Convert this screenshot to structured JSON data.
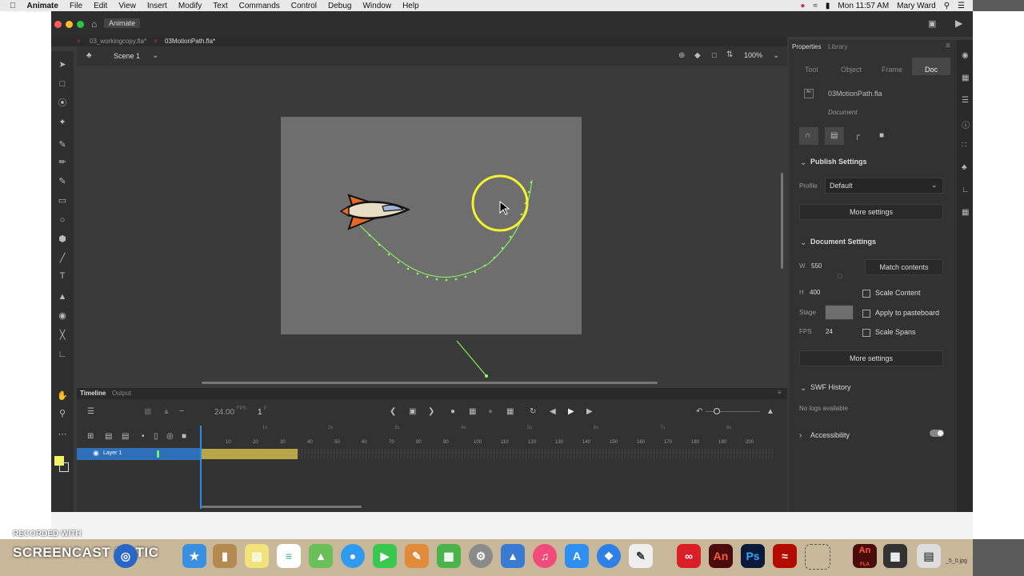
{
  "menubar": {
    "app_name": "Animate",
    "items": [
      "File",
      "Edit",
      "View",
      "Insert",
      "Modify",
      "Text",
      "Commands",
      "Control",
      "Debug",
      "Window",
      "Help"
    ],
    "clock": "Mon 11:57 AM",
    "user": "Mary Ward"
  },
  "titlebar": {
    "workspace_label": "Animate"
  },
  "doc_tabs": [
    "03_workingcopy.fla*",
    "03MotionPath.fla*"
  ],
  "scene": {
    "name": "Scene 1",
    "zoom": "100%"
  },
  "timeline": {
    "tabs": [
      "Timeline",
      "Output"
    ],
    "fps": "24.00",
    "fps_unit": "FPS",
    "current_frame": "1",
    "frame_suffix": "F",
    "layer_name": "Layer 1",
    "ruler": [
      "10",
      "20",
      "30",
      "40",
      "50",
      "60",
      "70",
      "80",
      "90",
      "100",
      "110",
      "120",
      "130",
      "140",
      "150",
      "160",
      "170",
      "180",
      "190",
      "200"
    ],
    "seconds": [
      "1s",
      "2s",
      "3s",
      "4s",
      "5s",
      "6s",
      "7s",
      "8s"
    ]
  },
  "properties": {
    "tabs": [
      "Properties",
      "Library"
    ],
    "sub_tabs": [
      "Tool",
      "Object",
      "Frame",
      "Doc"
    ],
    "file_name": "03MotionPath.fla",
    "doc_label": "Document",
    "publish_settings": "Publish Settings",
    "profile_label": "Profile",
    "profile_value": "Default",
    "more_settings": "More settings",
    "document_settings": "Document Settings",
    "w_label": "W",
    "w_value": "550",
    "h_label": "H",
    "h_value": "400",
    "match_contents": "Match contents",
    "scale_content": "Scale Content",
    "stage_label": "Stage",
    "apply_pasteboard": "Apply to pasteboard",
    "fps_label": "FPS",
    "fps_value": "24",
    "scale_spans": "Scale Spans",
    "more_settings_2": "More settings",
    "swf_history": "SWF History",
    "no_logs": "No logs available",
    "accessibility": "Accessibility"
  },
  "watermark": {
    "line1": "RECORDED WITH",
    "line2": "SCREENCAST  MATIC"
  },
  "dock": {
    "an_label": "An",
    "ps_label": "Ps",
    "an_fla_label": "An",
    "an_fla_sub": "FLA",
    "file_caption": "_5_0.jpg"
  },
  "colors": {
    "accent": "#2d8ceb",
    "stage": "#6e6e6e",
    "path": "#8cff5a",
    "tween": "#b9a648",
    "cursor_ring": "#f2f230"
  }
}
